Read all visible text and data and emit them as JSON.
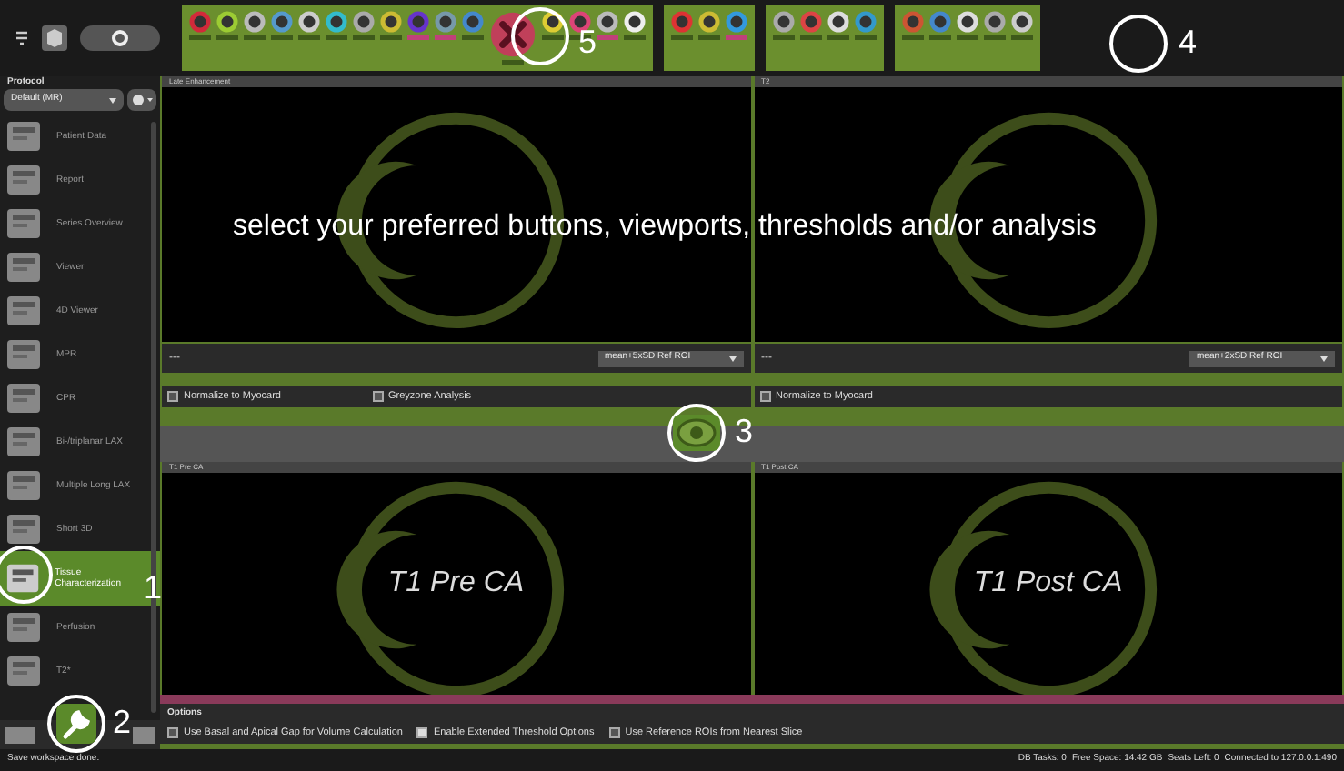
{
  "toolbar": {
    "groups": [
      {
        "icons": [
          {
            "color": "#d22a3a",
            "selected": false
          },
          {
            "color": "#9ccc33",
            "selected": false
          },
          {
            "color": "#bbbbbb",
            "selected": false
          },
          {
            "color": "#5599cc",
            "selected": false
          },
          {
            "color": "#cccccc",
            "selected": false
          },
          {
            "color": "#33bbcc",
            "selected": false
          },
          {
            "color": "#aaaaaa",
            "selected": false
          },
          {
            "color": "#ccbb33",
            "selected": false
          },
          {
            "color": "#6633cc",
            "selected": true
          },
          {
            "color": "#7799aa",
            "selected": true
          },
          {
            "color": "#4488cc",
            "selected": false
          },
          {
            "kind": "delete",
            "selected": false
          },
          {
            "color": "#ddcc33",
            "selected": false
          },
          {
            "color": "#dd4477",
            "selected": false
          },
          {
            "color": "#bbbbbb",
            "selected": true
          },
          {
            "color": "#eeeeee",
            "selected": false
          }
        ]
      },
      {
        "icons": [
          {
            "color": "#dd3333",
            "selected": false
          },
          {
            "color": "#ccbb33",
            "selected": false
          },
          {
            "color": "#3399dd",
            "selected": true
          }
        ]
      },
      {
        "icons": [
          {
            "color": "#aaaaaa",
            "selected": false
          },
          {
            "color": "#dd4444",
            "selected": false
          },
          {
            "color": "#dddddd",
            "selected": false
          },
          {
            "color": "#3399cc",
            "selected": false
          }
        ]
      },
      {
        "icons": [
          {
            "color": "#cc5533",
            "selected": false
          },
          {
            "color": "#4488cc",
            "selected": false
          },
          {
            "color": "#dddddd",
            "selected": false
          },
          {
            "color": "#aaaaaa",
            "selected": false
          },
          {
            "color": "#cccccc",
            "selected": false
          }
        ]
      }
    ]
  },
  "sidebar": {
    "title": "Protocol",
    "protocol": "Default (MR)",
    "items": [
      {
        "label": "Patient Data",
        "selected": false
      },
      {
        "label": "Report",
        "selected": false
      },
      {
        "label": "Series Overview",
        "selected": false
      },
      {
        "label": "Viewer",
        "selected": false
      },
      {
        "label": "4D Viewer",
        "selected": false
      },
      {
        "label": "MPR",
        "selected": false
      },
      {
        "label": "CPR",
        "selected": false
      },
      {
        "label": "Bi-/triplanar LAX",
        "selected": false
      },
      {
        "label": "Multiple Long LAX",
        "selected": false
      },
      {
        "label": "Short 3D",
        "selected": false
      },
      {
        "label": "Tissue Characterization",
        "selected": true
      },
      {
        "label": "Perfusion",
        "selected": false
      },
      {
        "label": "T2*",
        "selected": false
      }
    ]
  },
  "top_viewports": [
    {
      "title": "Late Enhancement",
      "value": "---",
      "threshold": "mean+5xSD Ref ROI",
      "options": [
        {
          "label": "Normalize to Myocard",
          "checked": false
        },
        {
          "label": "Greyzone Analysis",
          "checked": false
        }
      ]
    },
    {
      "title": "T2",
      "value": "---",
      "threshold": "mean+2xSD Ref ROI",
      "options": [
        {
          "label": "Normalize to Myocard",
          "checked": false
        }
      ]
    }
  ],
  "bottom_viewports": [
    {
      "title": "T1 Pre CA",
      "caption": "T1 Pre CA"
    },
    {
      "title": "T1 Post CA",
      "caption": "T1 Post CA"
    }
  ],
  "options": {
    "title": "Options",
    "items": [
      {
        "label": "Use Basal and Apical Gap for Volume Calculation",
        "checked": false
      },
      {
        "label": "Enable Extended Threshold Options",
        "checked": true
      },
      {
        "label": "Use Reference ROIs from Nearest Slice",
        "checked": false
      }
    ]
  },
  "status_bar": {
    "message": "Save workspace done.",
    "items": [
      "DB Tasks: 0",
      "Free Space: 14.42 GB",
      "Seats Left: 0",
      "Connected to 127.0.0.1:490"
    ]
  },
  "overlay_text": "select your preferred buttons, viewports, thresholds and/or analysis",
  "annotations": [
    {
      "label": "1",
      "kind": "plain"
    },
    {
      "label": "2",
      "kind": "wrench"
    },
    {
      "label": "3",
      "kind": "eye"
    },
    {
      "label": "4",
      "kind": "plain"
    },
    {
      "label": "5",
      "kind": "plain"
    }
  ]
}
